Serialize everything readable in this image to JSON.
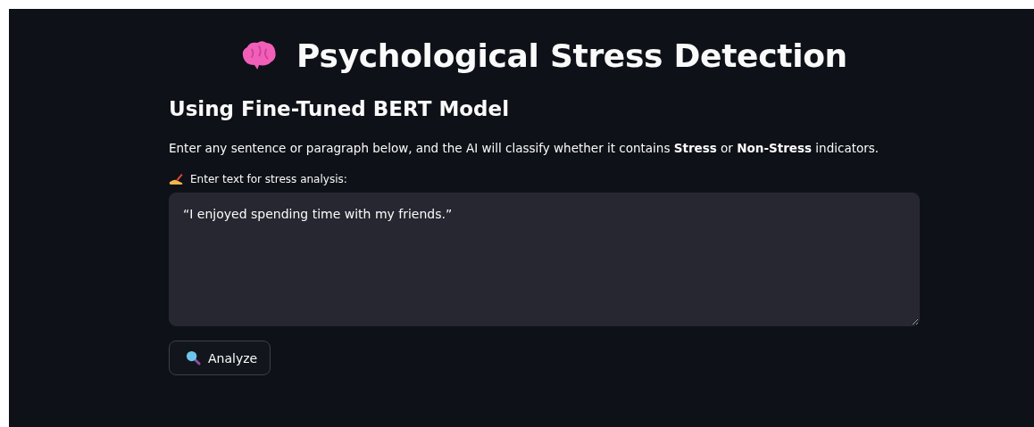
{
  "title": "Psychological Stress Detection",
  "subtitle": "Using Fine-Tuned BERT Model",
  "description": "Enter any sentence or paragraph below, and the AI will classify whether it contains **Stress** or **Non-Stress** indicators.",
  "input": {
    "label": "Enter text for stress analysis:",
    "value": "“I enjoyed spending time with my friends.”"
  },
  "buttons": [
    {
      "label": "Analyze"
    }
  ]
}
